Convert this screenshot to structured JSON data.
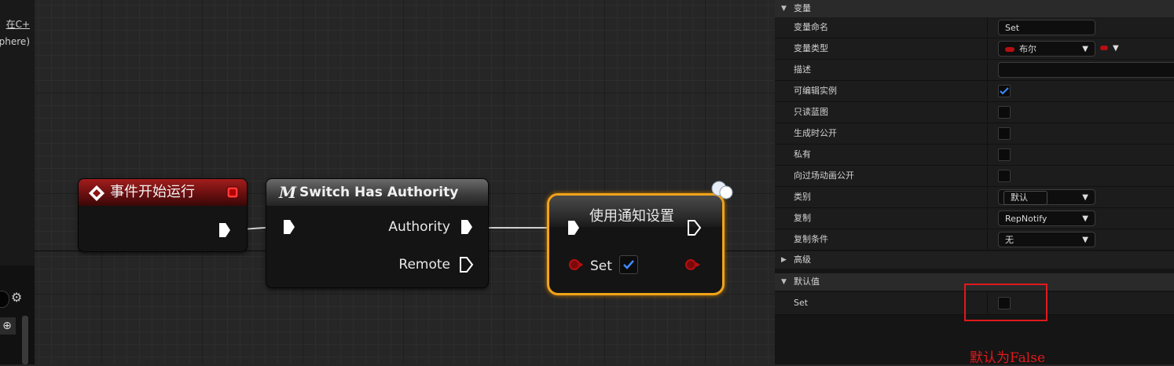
{
  "left_panel": {
    "text_lines": [
      "在C+",
      "phere)"
    ]
  },
  "graph": {
    "nodes": {
      "begin_play": {
        "title": "事件开始运行",
        "accent": "#8e1414"
      },
      "switch_authority": {
        "title": "Switch Has Authority",
        "macro_glyph": "M",
        "pin_authority": "Authority",
        "pin_remote": "Remote"
      },
      "set_with_notify": {
        "title": "使用通知设置",
        "pin_set": "Set",
        "set_checked": true,
        "highlight": "#f0a31a"
      }
    }
  },
  "details": {
    "variable_section": {
      "title": "变量",
      "rows": {
        "name": {
          "label": "变量命名",
          "value": "Set"
        },
        "type": {
          "label": "变量类型",
          "value": "布尔",
          "color": "#b50f12"
        },
        "description": {
          "label": "描述",
          "value": ""
        },
        "instance_editable": {
          "label": "可编辑实例",
          "checked": true
        },
        "blueprint_read_only": {
          "label": "只读蓝图",
          "checked": false
        },
        "expose_on_spawn": {
          "label": "生成时公开",
          "checked": false
        },
        "private": {
          "label": "私有",
          "checked": false
        },
        "expose_to_cinematics": {
          "label": "向过场动画公开",
          "checked": false
        },
        "category": {
          "label": "类别",
          "value": "默认"
        },
        "replication": {
          "label": "复制",
          "value": "RepNotify"
        },
        "replication_condition": {
          "label": "复制条件",
          "value": "无"
        }
      }
    },
    "advanced_section": {
      "title": "高级"
    },
    "default_value_section": {
      "title": "默认值",
      "rows": {
        "set": {
          "label": "Set",
          "checked": false
        }
      }
    }
  },
  "annotation": {
    "text": "默认为False",
    "color": "#e0191c"
  }
}
